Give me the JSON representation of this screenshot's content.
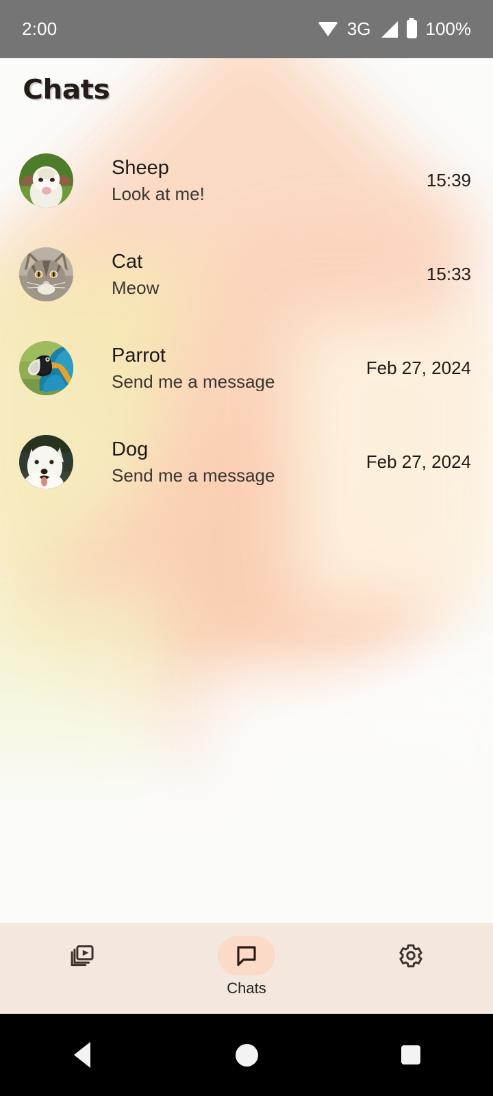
{
  "status_bar": {
    "time": "2:00",
    "network_type": "3G",
    "battery_percent": "100%",
    "icons": [
      "wifi-icon",
      "cellular-signal-icon",
      "battery-icon"
    ]
  },
  "header": {
    "title": "Chats"
  },
  "chats": [
    {
      "name": "Sheep",
      "preview": "Look at me!",
      "time": "15:39",
      "avatar": "sheep-avatar"
    },
    {
      "name": "Cat",
      "preview": "Meow",
      "time": "15:33",
      "avatar": "cat-avatar"
    },
    {
      "name": "Parrot",
      "preview": "Send me a message",
      "time": "Feb 27, 2024",
      "avatar": "parrot-avatar"
    },
    {
      "name": "Dog",
      "preview": "Send me a message",
      "time": "Feb 27, 2024",
      "avatar": "dog-avatar"
    }
  ],
  "bottom_nav": {
    "items": [
      {
        "label": "",
        "icon": "video-library-icon",
        "active": false
      },
      {
        "label": "Chats",
        "icon": "chat-bubble-icon",
        "active": true
      },
      {
        "label": "",
        "icon": "gear-icon",
        "active": false
      }
    ]
  },
  "system_nav": {
    "back": "back-button",
    "home": "home-button",
    "recents": "recents-button"
  },
  "colors": {
    "status_bar_bg": "#757575",
    "page_bg": "#fbfbfa",
    "nav_bg": "#f4e8de",
    "active_pill": "#fbdbc7",
    "icon_dark": "#3b322c",
    "text_primary": "#1d1b19"
  }
}
